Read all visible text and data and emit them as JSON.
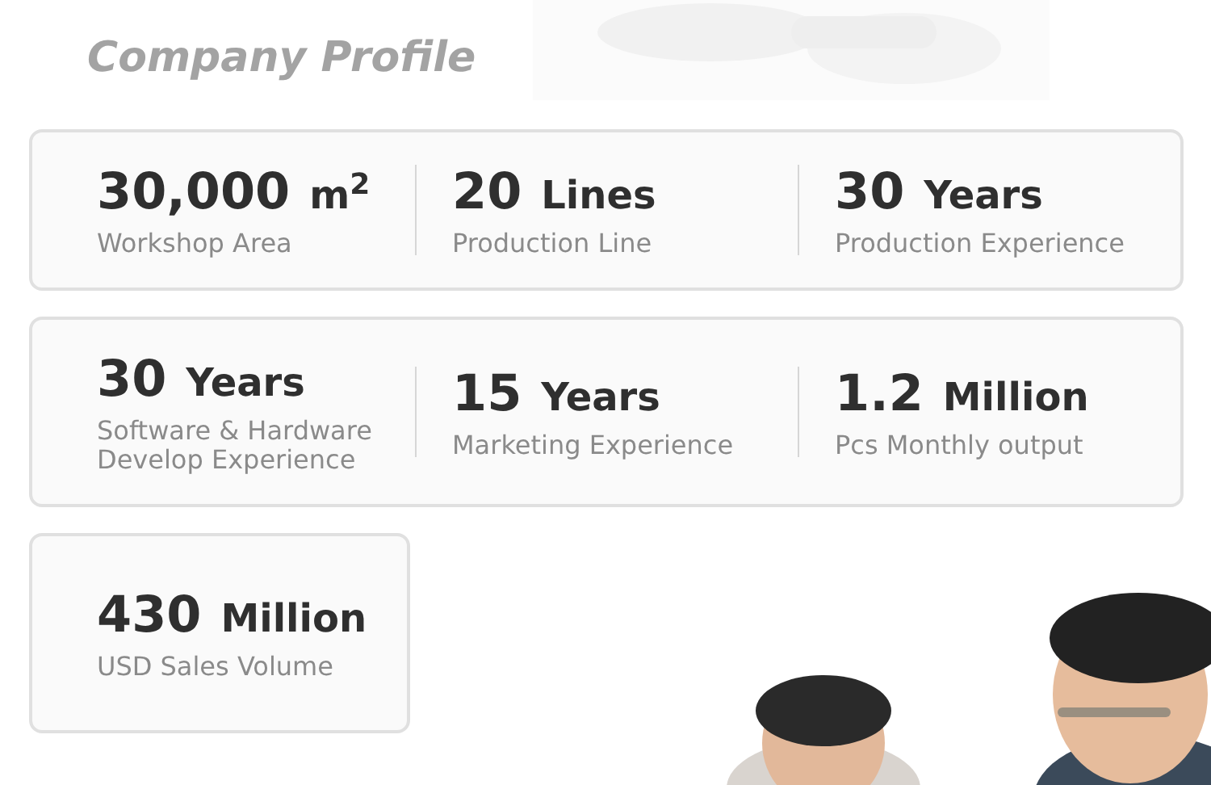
{
  "title": "Company Profile",
  "cards": [
    {
      "stats": [
        {
          "value": "30,000",
          "unit": "m$^{2}$",
          "label": "Workshop Area"
        },
        {
          "value": "20",
          "unit": "Lines",
          "label": "Production Line"
        },
        {
          "value": "30",
          "unit": "Years",
          "label": "Production Experience"
        }
      ]
    },
    {
      "stats": [
        {
          "value": "30",
          "unit": "Years",
          "label": "Software & Hardware Develop Experience"
        },
        {
          "value": "15",
          "unit": "Years",
          "label": "Marketing Experience"
        },
        {
          "value": "1.2",
          "unit": "Million",
          "label": "Pcs Monthly output"
        }
      ]
    },
    {
      "stats": [
        {
          "value": "430",
          "unit": "Million",
          "label": "USD Sales Volume"
        }
      ]
    }
  ]
}
